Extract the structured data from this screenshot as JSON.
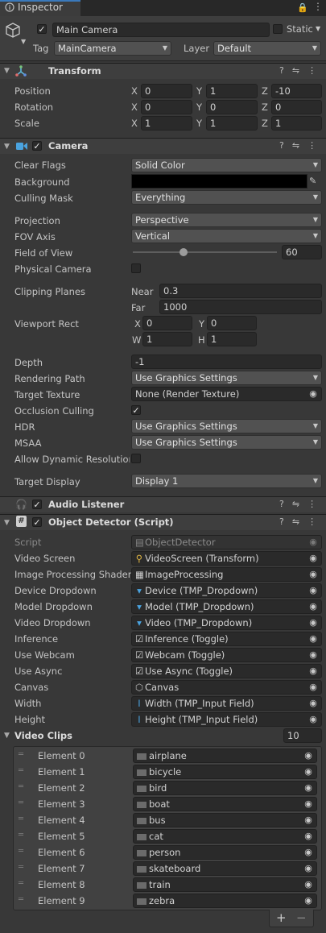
{
  "tab": {
    "title": "Inspector"
  },
  "gameobject": {
    "active": true,
    "name": "Main Camera",
    "static_label": "Static",
    "tag_label": "Tag",
    "tag_value": "MainCamera",
    "layer_label": "Layer",
    "layer_value": "Default"
  },
  "transform": {
    "title": "Transform",
    "rows": [
      {
        "label": "Position",
        "x": "0",
        "y": "1",
        "z": "-10"
      },
      {
        "label": "Rotation",
        "x": "0",
        "y": "0",
        "z": "0"
      },
      {
        "label": "Scale",
        "x": "1",
        "y": "1",
        "z": "1"
      }
    ],
    "axis": {
      "x": "X",
      "y": "Y",
      "z": "Z"
    }
  },
  "camera": {
    "title": "Camera",
    "clear_flags": {
      "label": "Clear Flags",
      "value": "Solid Color"
    },
    "background": {
      "label": "Background",
      "color": "#000000"
    },
    "culling_mask": {
      "label": "Culling Mask",
      "value": "Everything"
    },
    "projection": {
      "label": "Projection",
      "value": "Perspective"
    },
    "fov_axis": {
      "label": "FOV Axis",
      "value": "Vertical"
    },
    "field_of_view": {
      "label": "Field of View",
      "value": "60",
      "slider_fraction": 0.35
    },
    "physical_camera": {
      "label": "Physical Camera"
    },
    "clipping": {
      "label": "Clipping Planes",
      "near_label": "Near",
      "near": "0.3",
      "far_label": "Far",
      "far": "1000"
    },
    "viewport": {
      "label": "Viewport Rect",
      "x_label": "X",
      "x": "0",
      "y_label": "Y",
      "y": "0",
      "w_label": "W",
      "w": "1",
      "h_label": "H",
      "h": "1"
    },
    "depth": {
      "label": "Depth",
      "value": "-1"
    },
    "rendering_path": {
      "label": "Rendering Path",
      "value": "Use Graphics Settings"
    },
    "target_texture": {
      "label": "Target Texture",
      "value": "None (Render Texture)"
    },
    "occlusion_culling": {
      "label": "Occlusion Culling"
    },
    "hdr": {
      "label": "HDR",
      "value": "Use Graphics Settings"
    },
    "msaa": {
      "label": "MSAA",
      "value": "Use Graphics Settings"
    },
    "dynamic_resolution": {
      "label": "Allow Dynamic Resolution"
    },
    "target_display": {
      "label": "Target Display",
      "value": "Display 1"
    }
  },
  "audio_listener": {
    "title": "Audio Listener"
  },
  "object_detector": {
    "title": "Object Detector (Script)",
    "script": {
      "label": "Script",
      "value": "ObjectDetector"
    },
    "fields": [
      {
        "label": "Video Screen",
        "value": "VideoScreen (Transform)",
        "icon": "transform-icon"
      },
      {
        "label": "Image Processing Shader",
        "value": "ImageProcessing",
        "icon": "shader-icon"
      },
      {
        "label": "Device Dropdown",
        "value": "Device (TMP_Dropdown)",
        "icon": "dropdown-icon"
      },
      {
        "label": "Model Dropdown",
        "value": "Model (TMP_Dropdown)",
        "icon": "dropdown-icon"
      },
      {
        "label": "Video Dropdown",
        "value": "Video (TMP_Dropdown)",
        "icon": "dropdown-icon"
      },
      {
        "label": "Inference",
        "value": "Inference (Toggle)",
        "icon": "toggle-icon"
      },
      {
        "label": "Use Webcam",
        "value": "Webcam (Toggle)",
        "icon": "toggle-icon"
      },
      {
        "label": "Use Async",
        "value": "Use Async (Toggle)",
        "icon": "toggle-icon"
      },
      {
        "label": "Canvas",
        "value": "Canvas",
        "icon": "canvas-icon"
      },
      {
        "label": "Width",
        "value": "Width (TMP_Input Field)",
        "icon": "inputfield-icon"
      },
      {
        "label": "Height",
        "value": "Height (TMP_Input Field)",
        "icon": "inputfield-icon"
      }
    ],
    "video_clips": {
      "label": "Video Clips",
      "count": "10",
      "elements": [
        {
          "label": "Element 0",
          "value": "airplane"
        },
        {
          "label": "Element 1",
          "value": "bicycle"
        },
        {
          "label": "Element 2",
          "value": "bird"
        },
        {
          "label": "Element 3",
          "value": "boat"
        },
        {
          "label": "Element 4",
          "value": "bus"
        },
        {
          "label": "Element 5",
          "value": "cat"
        },
        {
          "label": "Element 6",
          "value": "person"
        },
        {
          "label": "Element 7",
          "value": "skateboard"
        },
        {
          "label": "Element 8",
          "value": "train"
        },
        {
          "label": "Element 9",
          "value": "zebra"
        }
      ],
      "add": "+",
      "remove": "−"
    }
  },
  "colors": {
    "accent": "#3a79bb",
    "panel": "#383838",
    "field": "#2a2a2a",
    "header": "#3e3e3e"
  }
}
